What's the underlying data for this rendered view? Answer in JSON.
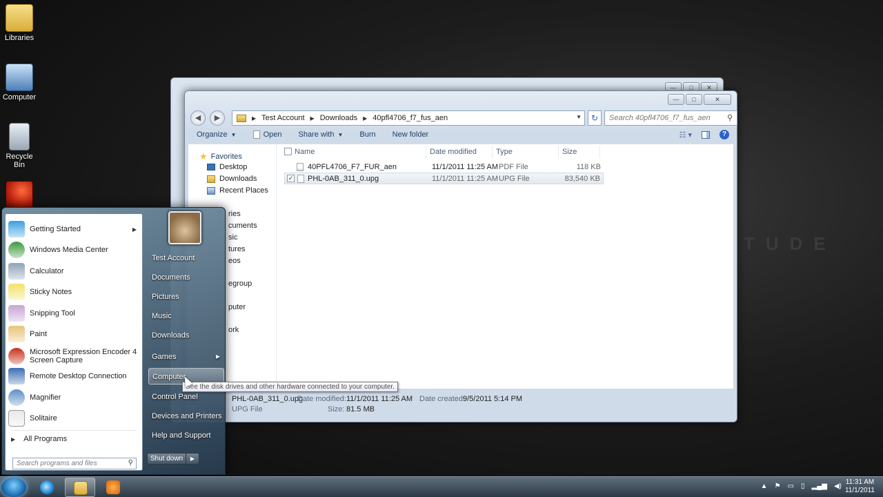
{
  "desktop": {
    "icons": [
      {
        "label": "Libraries",
        "icon": "libraries-icon"
      },
      {
        "label": "Computer",
        "icon": "computer-icon"
      },
      {
        "label": "Recycle Bin",
        "icon": "recycle-bin-icon"
      },
      {
        "label": "",
        "icon": "expression-encoder-icon"
      }
    ],
    "watermark": "TUDE"
  },
  "explorer": {
    "breadcrumb": [
      "Test Account",
      "Downloads",
      "40pfl4706_f7_fus_aen"
    ],
    "search_placeholder": "Search 40pfl4706_f7_fus_aen",
    "toolbar": {
      "organize": "Organize",
      "open": "Open",
      "share_with": "Share with",
      "burn": "Burn",
      "new_folder": "New folder"
    },
    "nav": {
      "favorites": "Favorites",
      "items": [
        "Desktop",
        "Downloads",
        "Recent Places"
      ],
      "peek_items": [
        "ries",
        "cuments",
        "sic",
        "tures",
        "eos",
        "egroup",
        "puter",
        "ork"
      ]
    },
    "columns": [
      "Name",
      "Date modified",
      "Type",
      "Size"
    ],
    "files": [
      {
        "name": "40PFL4706_F7_FUR_aen",
        "date": "11/1/2011 11:25 AM",
        "type": "PDF File",
        "size": "118 KB",
        "checked": false
      },
      {
        "name": "PHL-0AB_311_0.upg",
        "date": "11/1/2011 11:25 AM",
        "type": "UPG File",
        "size": "83,540 KB",
        "checked": true
      }
    ],
    "details": {
      "filename": "PHL-0AB_311_0.upg",
      "filetype": "UPG File",
      "date_modified_label": "Date modified:",
      "date_modified": "11/1/2011 11:25 AM",
      "size_label": "Size:",
      "size": "81.5 MB",
      "date_created_label": "Date created:",
      "date_created": "9/5/2011 5:14 PM"
    }
  },
  "start_menu": {
    "programs": [
      {
        "label": "Getting Started",
        "submenu": true,
        "color": "#3aa0e0"
      },
      {
        "label": "Windows Media Center",
        "submenu": false,
        "color": "#3c9a3c"
      },
      {
        "label": "Calculator",
        "submenu": false,
        "color": "#8fa3b8"
      },
      {
        "label": "Sticky Notes",
        "submenu": false,
        "color": "#f1e26a"
      },
      {
        "label": "Snipping Tool",
        "submenu": false,
        "color": "#c7a4d6"
      },
      {
        "label": "Paint",
        "submenu": false,
        "color": "#e6c37a"
      },
      {
        "label": "Microsoft Expression Encoder 4",
        "label2": "Screen Capture",
        "submenu": false,
        "color": "#c8301a"
      },
      {
        "label": "Remote Desktop Connection",
        "submenu": false,
        "color": "#3e6fb5"
      },
      {
        "label": "Magnifier",
        "submenu": false,
        "color": "#5d8fc8"
      },
      {
        "label": "Solitaire",
        "submenu": false,
        "color": "#e8e8e8"
      }
    ],
    "all_programs": "All Programs",
    "search_placeholder": "Search programs and files",
    "right": [
      {
        "label": "Test Account"
      },
      {
        "label": "Documents"
      },
      {
        "label": "Pictures"
      },
      {
        "label": "Music"
      },
      {
        "label": "Downloads"
      },
      {
        "label": "Games",
        "submenu": true
      },
      {
        "label": "Computer",
        "hover": true
      },
      {
        "label": "Control Panel"
      },
      {
        "label": "Devices and Printers"
      },
      {
        "label": "Help and Support"
      }
    ],
    "shutdown": "Shut down",
    "tooltip": "See the disk drives and other hardware connected to your computer."
  },
  "taskbar": {
    "clock_time": "11:31 AM",
    "clock_date": "11/1/2011",
    "apps": [
      "internet-explorer-icon",
      "windows-explorer-icon",
      "media-player-icon"
    ]
  }
}
